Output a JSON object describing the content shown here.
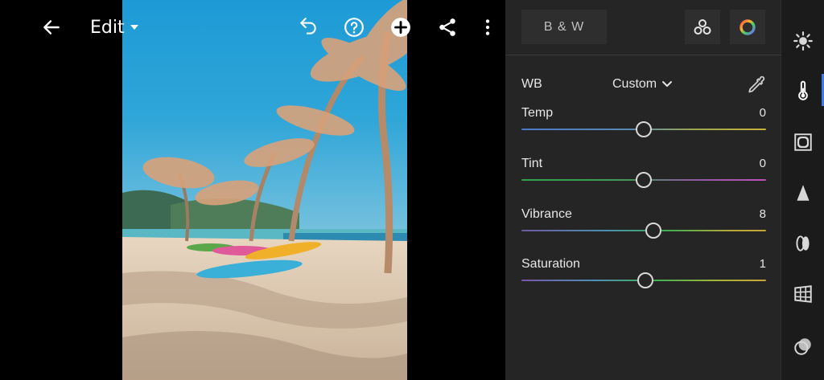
{
  "header": {
    "mode_label": "Edit"
  },
  "profile": {
    "bw_label": "B & W"
  },
  "white_balance": {
    "label": "WB",
    "mode": "Custom"
  },
  "sliders": [
    {
      "id": "temp",
      "label": "Temp",
      "value": "0",
      "position": 0.5
    },
    {
      "id": "tint",
      "label": "Tint",
      "value": "0",
      "position": 0.5
    },
    {
      "id": "vibrance",
      "label": "Vibrance",
      "value": "8",
      "position": 0.54
    },
    {
      "id": "saturation",
      "label": "Saturation",
      "value": "1",
      "position": 0.505
    }
  ],
  "tool_rail": {
    "items": [
      "light-icon",
      "color-icon",
      "effects-icon",
      "detail-icon",
      "optics-icon",
      "geometry-icon",
      "presets-icon"
    ],
    "active": "color-icon"
  },
  "colors": {
    "panel_bg": "#252525",
    "rail_bg": "#1b1b1b",
    "accent": "#3d7be6"
  }
}
